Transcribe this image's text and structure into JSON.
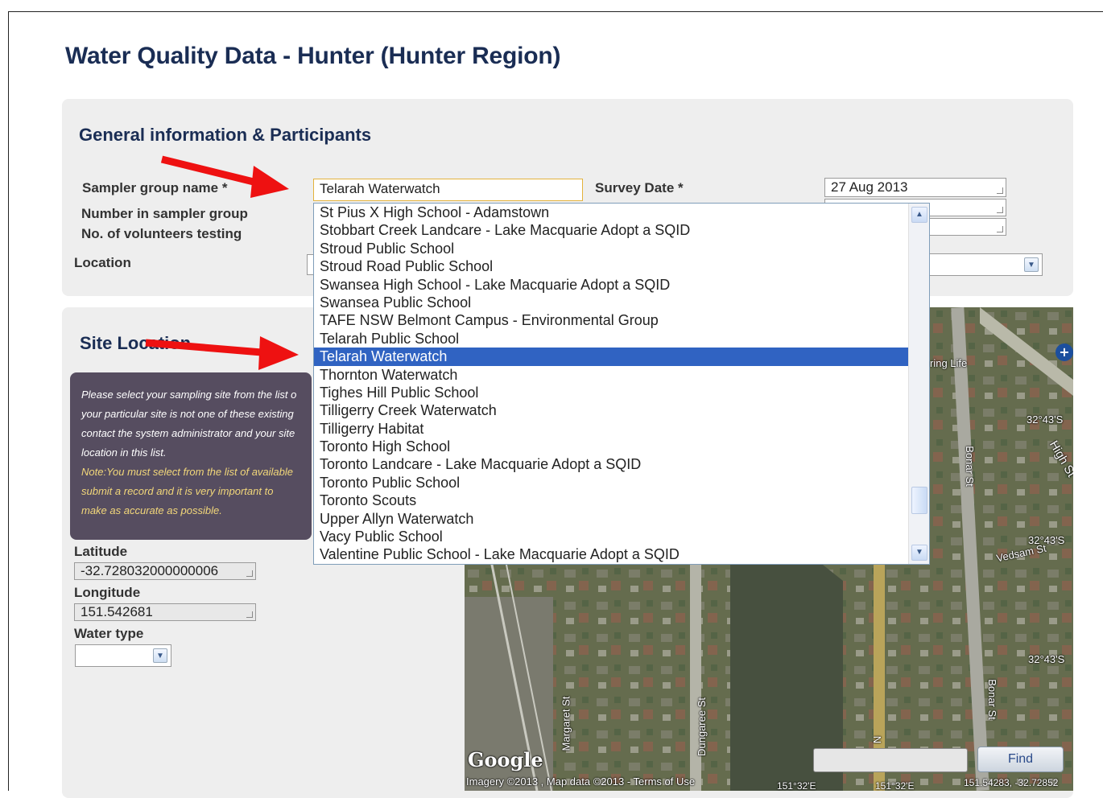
{
  "page": {
    "title": "Water Quality Data - Hunter (Hunter Region)"
  },
  "general": {
    "section_title": "General information & Participants",
    "sampler_group_label": "Sampler group name *",
    "sampler_group_value": "Telarah Waterwatch",
    "number_in_group_label": "Number in sampler group",
    "volunteers_label": "No. of volunteers testing",
    "location_label": "Location",
    "survey_date_label": "Survey Date *",
    "survey_date_value": "27 Aug 2013"
  },
  "dropdown": {
    "selected_index": 8,
    "options": [
      "St Pius X High School - Adamstown",
      "Stobbart Creek Landcare - Lake Macquarie Adopt a SQID",
      "Stroud Public School",
      "Stroud Road Public School",
      "Swansea High School - Lake Macquarie Adopt a SQID",
      "Swansea Public School",
      "TAFE NSW Belmont Campus - Environmental Group",
      "Telarah Public School",
      "Telarah Waterwatch",
      "Thornton Waterwatch",
      "Tighes Hill Public School",
      "Tilligerry Creek Waterwatch",
      "Tilligerry Habitat",
      "Toronto High School",
      "Toronto Landcare - Lake Macquarie Adopt a SQID",
      "Toronto Public School",
      "Toronto Scouts",
      "Upper Allyn Waterwatch",
      "Vacy Public School",
      "Valentine Public School - Lake Macquarie Adopt a SQID"
    ]
  },
  "site": {
    "section_title": "Site Location",
    "info_text": "Please select your sampling site from the list o your particular site is not one of these existing contact the system administrator and your site location in this list.",
    "info_note": "Note:You must select from the list of available submit a record and it is very important to make as accurate as possible.",
    "latitude_label": "Latitude",
    "latitude_value": "-32.728032000000006",
    "longitude_label": "Longitude",
    "longitude_value": "151.542681",
    "water_type_label": "Water type"
  },
  "map": {
    "labels": {
      "street_high": "High St",
      "street_bonar": "Bonar St",
      "street_bonar2": "Bonar St",
      "street_margaret": "Margaret St",
      "street_dungaree": "Dungaree St",
      "street_vedsam": "Vedsam St",
      "poi": "ring Life",
      "lat1": "32°43'S",
      "lat2": "32°43'S",
      "lat3": "32°43'S",
      "copyright": "Imagery ©2013 , Map data ©2013 - Terms of Use",
      "lon1": "151°32'E",
      "lon2": "151°32'E",
      "coords": "151.54283, -32.72852",
      "google": "Google",
      "route": "N"
    },
    "find_label": "Find"
  },
  "colors": {
    "title": "#1a2d54",
    "selected_option": "#3063c2",
    "info_box": "#564d60",
    "annotation_arrow": "#ee1111"
  }
}
